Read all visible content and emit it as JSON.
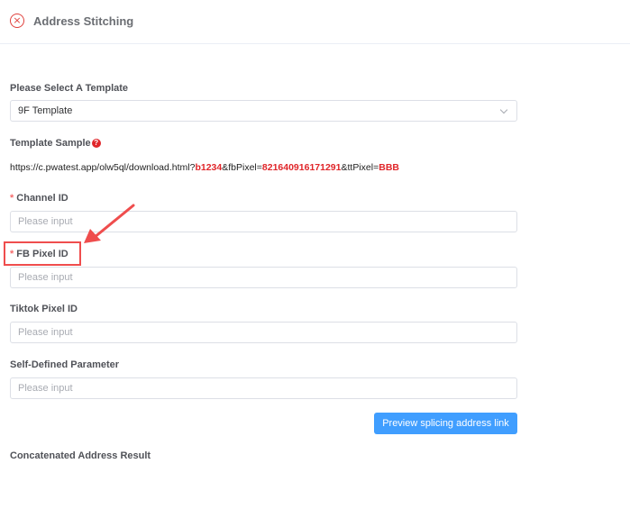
{
  "header": {
    "title": "Address Stitching",
    "close_glyph": "×",
    "close_icon": "close-circle-icon",
    "accent_color": "#e0403c"
  },
  "template": {
    "label": "Please Select A Template",
    "selected": "9F Template"
  },
  "sample": {
    "label": "Template Sample",
    "help_glyph": "?",
    "parts": [
      {
        "text": "https://c.pwatest.app/olw5ql/download.html?",
        "highlight": false
      },
      {
        "text": "b1234",
        "highlight": true
      },
      {
        "text": "&fbPixel=",
        "highlight": false
      },
      {
        "text": "821640916171291",
        "highlight": true
      },
      {
        "text": "&ttPixel=",
        "highlight": false
      },
      {
        "text": "BBB",
        "highlight": true
      }
    ]
  },
  "fields": {
    "required_mark": "*",
    "channel": {
      "label": "Channel ID",
      "placeholder": "Please input",
      "value": ""
    },
    "fb_pixel": {
      "label": "FB Pixel ID",
      "placeholder": "Please input",
      "value": ""
    },
    "tiktok_pixel": {
      "label": "Tiktok Pixel ID",
      "placeholder": "Please input",
      "value": ""
    },
    "self_defined": {
      "label": "Self-Defined Parameter",
      "placeholder": "Please input",
      "value": ""
    }
  },
  "actions": {
    "preview_label": "Preview splicing address link",
    "button_color": "#409eff"
  },
  "result": {
    "label": "Concatenated Address Result"
  },
  "annotation": {
    "color": "#ef4d4d"
  }
}
